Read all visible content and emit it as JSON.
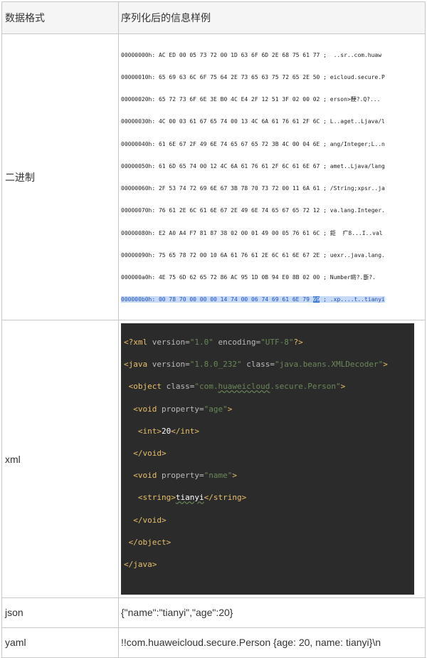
{
  "header": {
    "col1": "数据格式",
    "col2": "序列化后的信息样例"
  },
  "rows": {
    "binary": {
      "label": "二进制",
      "hex_lines": [
        "00000000h: AC ED 00 05 73 72 00 1D 63 6F 6D 2E 68 75 61 77 ;  ..sr..com.huaw",
        "00000010h: 65 69 63 6C 6F 75 64 2E 73 65 63 75 72 65 2E 50 ; eicloud.secure.P",
        "00000020h: 65 72 73 6F 6E 3E B0 4C E4 2F 12 51 3F 02 00 02 ; erson>鞕?.Q?...",
        "00000030h: 4C 00 03 61 67 65 74 00 13 4C 6A 61 76 61 2F 6C ; L..aget..Ljava/l",
        "00000040h: 61 6E 67 2F 49 6E 74 65 67 65 72 3B 4C 00 04 6E ; ang/Integer;L..n",
        "00000050h: 61 6D 65 74 00 12 4C 6A 61 76 61 2F 6C 61 6E 67 ; amet..Ljava/lang",
        "00000060h: 2F 53 74 72 69 6E 67 3B 78 70 73 72 00 11 6A 61 ; /String;xpsr..ja",
        "00000070h: 76 61 2E 6C 61 6E 67 2E 49 6E 74 65 67 65 72 12 ; va.lang.Integer.",
        "00000080h: E2 A0 A4 F7 81 87 38 02 00 01 49 00 05 76 61 6C ; 鉅  疒8...I..val",
        "00000090h: 75 65 78 72 00 10 6A 61 76 61 2E 6C 61 6E 67 2E ; uexr..java.lang.",
        "000000a0h: 4E 75 6D 62 65 72 86 AC 95 1D 0B 94 E0 8B 02 00 ; Number啲?.斵?."
      ],
      "hex_last_prefix": "000000b0h: 00 78 70 00 00 00 14 74 00 06 74 69 61 6E 79 ",
      "hex_last_hi": "69",
      "hex_last_suffix": " ; .xp....t..tianyi"
    },
    "xml": {
      "label": "xml",
      "decl_tag_open": "<?xml",
      "decl_attr1": " version=",
      "decl_val1": "\"1.0\"",
      "decl_attr2": " encoding=",
      "decl_val2": "\"UTF-8\"",
      "decl_close": "?>",
      "java_tag": "<java",
      "java_attr1": " version=",
      "java_val1": "\"1.8.0_232\"",
      "java_attr2": " class=",
      "java_val2": "\"java.beans.XMLDecoder\"",
      "java_close": ">",
      "obj_tag": "<object",
      "obj_attr": " class=",
      "obj_val_pre": "\"com.",
      "obj_val_sq": "huaweicloud",
      "obj_val_post": ".secure.Person\"",
      "obj_close": ">",
      "void1_tag": "<void",
      "void1_attr": " property=",
      "void1_val": "\"age\"",
      "void1_close": ">",
      "int_open": "<int>",
      "int_text": "20",
      "int_close": "</int>",
      "void1_end": "</void>",
      "void2_tag": "<void",
      "void2_attr": " property=",
      "void2_val": "\"name\"",
      "void2_close": ">",
      "str_open": "<string>",
      "str_text": "tianyi",
      "str_close": "</string>",
      "void2_end": "</void>",
      "obj_end": "</object>",
      "java_end": "</java>"
    },
    "json": {
      "label": "json",
      "value": "{\"name\":\"tianyi\",\"age\":20}"
    },
    "yaml": {
      "label": "yaml",
      "value": "!!com.huaweicloud.secure.Person {age: 20, name: tianyi}\\n"
    }
  }
}
